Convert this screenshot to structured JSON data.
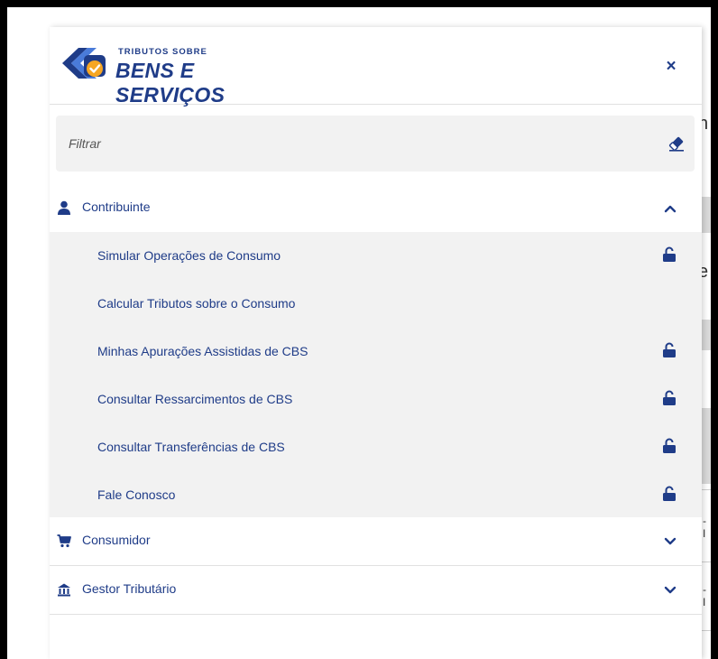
{
  "logo": {
    "small_text": "TRIBUTOS SOBRE",
    "big_text": "BENS E SERVIÇOS"
  },
  "close_label": "×",
  "filter": {
    "placeholder": "Filtrar",
    "value": ""
  },
  "menu": [
    {
      "label": "Contribuinte",
      "icon": "person-icon",
      "expanded": true,
      "items": [
        {
          "label": "Simular Operações de Consumo",
          "locked": true
        },
        {
          "label": "Calcular Tributos sobre o Consumo",
          "locked": false
        },
        {
          "label": "Minhas Apurações Assistidas de CBS",
          "locked": true
        },
        {
          "label": "Consultar Ressarcimentos de CBS",
          "locked": true
        },
        {
          "label": "Consultar Transferências de CBS",
          "locked": true
        },
        {
          "label": "Fale Conosco",
          "locked": true
        }
      ]
    },
    {
      "label": "Consumidor",
      "icon": "cart-icon",
      "expanded": false
    },
    {
      "label": "Gestor Tributário",
      "icon": "bank-icon",
      "expanded": false
    }
  ],
  "background": {
    "text_1": "n",
    "text_2": "e",
    "text_3": "- I",
    "text_4": "- I"
  },
  "colors": {
    "primary": "#1f3c88",
    "accent": "#f6a623",
    "submenu_bg": "#f2f2f2",
    "logo_light": "#4a7bd9"
  }
}
